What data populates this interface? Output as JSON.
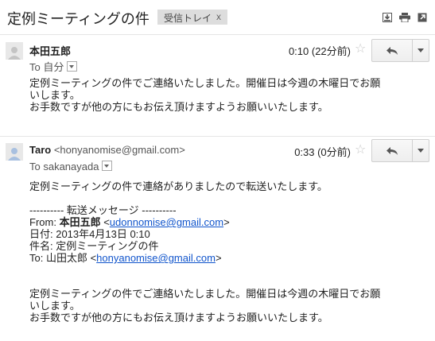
{
  "subject": "定例ミーティングの件",
  "label": {
    "name": "受信トレイ",
    "remove": "x"
  },
  "top_icons": [
    "archive-icon",
    "print-icon",
    "open-new-window-icon"
  ],
  "messages": [
    {
      "sender_name": "本田五郎",
      "sender_email": "",
      "time": "0:10 (22分前)",
      "to": "To 自分",
      "body": [
        "定例ミーティングの件でご連絡いたしました。開催日は今週の木曜日でお願",
        "いします。",
        "お手数ですが他の方にもお伝え頂けますようお願いいたします。"
      ]
    },
    {
      "sender_name": "Taro",
      "sender_email": "<honyanomise@gmail.com>",
      "time": "0:33 (0分前)",
      "to": "To sakanayada",
      "intro": "定例ミーティングの件で連絡がありましたので転送いたします。",
      "forward_header": "---------- 転送メッセージ ----------",
      "from_label": "From: ",
      "from_name": "本田五郎",
      "from_lt": " <",
      "from_email": "udonnomise@gmail.com",
      "gt": ">",
      "date_line": "日付: 2013年4月13日 0:10",
      "subject_line": "件名: 定例ミーティングの件",
      "to_label": "To: 山田太郎 <",
      "to_email": "honyanomise@gmail.com",
      "body": [
        "定例ミーティングの件でご連絡いたしました。開催日は今週の木曜日でお願",
        "いします。",
        "お手数ですが他の方にもお伝え頂けますようお願いいたします。"
      ]
    }
  ]
}
